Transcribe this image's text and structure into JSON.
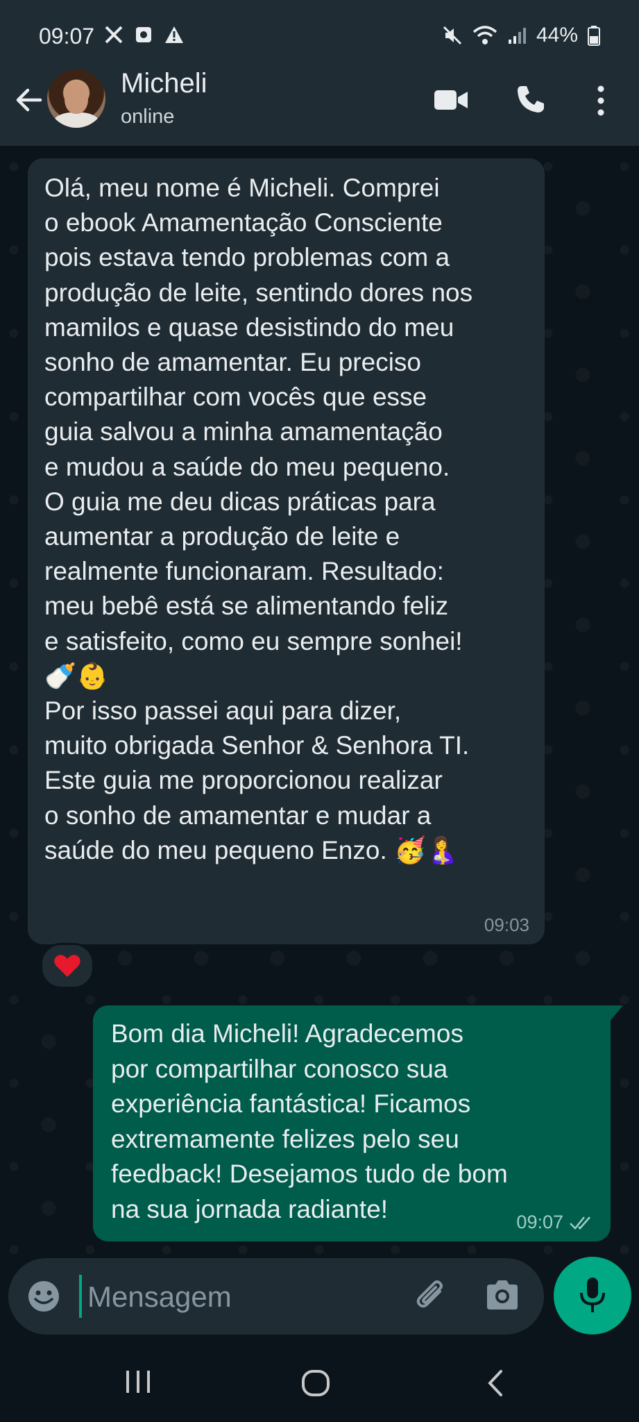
{
  "status_bar": {
    "time": "09:07",
    "battery": "44%",
    "left_icons": [
      "x-logo-icon",
      "app-notification-icon",
      "warning-icon"
    ],
    "right_icons": [
      "mute-icon",
      "wifi-icon",
      "signal-icon",
      "battery-icon"
    ]
  },
  "header": {
    "contact_name": "Micheli",
    "contact_status": "online",
    "icons": [
      "back-arrow-icon",
      "video-call-icon",
      "phone-call-icon",
      "more-options-icon"
    ]
  },
  "messages": [
    {
      "direction": "incoming",
      "text": "Olá, meu nome é Micheli. Comprei\no ebook Amamentação Consciente\npois estava tendo problemas com a\nprodução de leite, sentindo dores nos\nmamilos e quase desistindo do meu\nsonho de amamentar. Eu preciso\ncompartilhar com vocês que esse\nguia salvou a minha amamentação\ne mudou a saúde do meu pequeno.\nO guia me deu dicas práticas para\naumentar a produção de leite e\nrealmente funcionaram. Resultado:\nmeu bebê está se alimentando feliz\ne satisfeito, como eu sempre sonhei!\n🍼👶\nPor isso passei aqui para dizer,\nmuito obrigada Senhor & Senhora TI.\nEste guia me proporcionou realizar\no sonho de amamentar e mudar a\nsaúde do meu pequeno Enzo. 🥳🤱",
      "time": "09:03",
      "reaction": "❤️"
    },
    {
      "direction": "outgoing",
      "text": "Bom dia Micheli! Agradecemos\npor compartilhar conosco sua\nexperiência fantástica! Ficamos\nextremamente felizes pelo seu\nfeedback! Desejamos tudo de bom\nna sua jornada radiante!",
      "time": "09:07",
      "status": "read"
    }
  ],
  "composer": {
    "placeholder": "Mensagem",
    "icons": [
      "emoji-icon",
      "attach-icon",
      "camera-icon",
      "mic-icon"
    ]
  },
  "navbar": {
    "icons": [
      "recent-apps-icon",
      "home-icon",
      "back-icon"
    ]
  },
  "colors": {
    "background": "#0b141a",
    "header": "#1f2c34",
    "incoming_bubble": "#202c33",
    "outgoing_bubble": "#005c4b",
    "accent": "#00a884"
  }
}
